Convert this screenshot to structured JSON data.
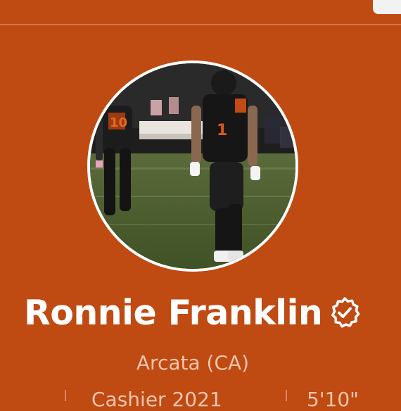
{
  "profile": {
    "name": "Ronnie Franklin",
    "verified_icon": "verified-badge-icon",
    "location": "Arcata (CA)",
    "avatar": {
      "subject": "football-player-photo",
      "jersey_numbers": [
        "10",
        "1"
      ]
    }
  },
  "meta_row": {
    "left_text": "Cashier 2021",
    "right_text": "5'10\""
  },
  "colors": {
    "background": "#BF4A12",
    "text_primary": "#FFFFFF",
    "text_secondary": "#F2C6AE"
  }
}
